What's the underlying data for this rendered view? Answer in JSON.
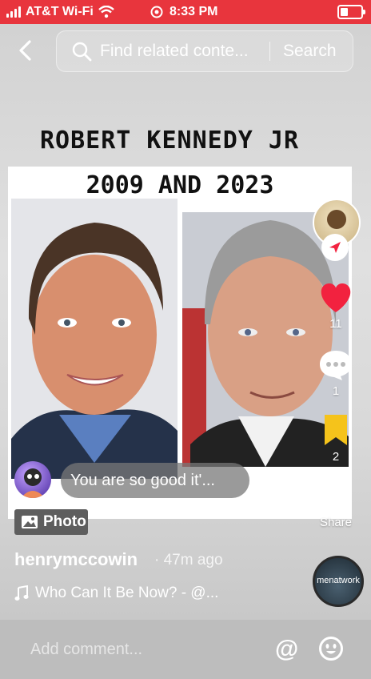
{
  "status": {
    "carrier": "AT&T Wi-Fi",
    "time": "8:33 PM",
    "bar_color": "#e8353d"
  },
  "search": {
    "placeholder": "Find related conte...",
    "button": "Search"
  },
  "post": {
    "title_line1": "ROBERT KENNEDY JR",
    "title_line2": "2009 AND 2023",
    "likes": "11",
    "comments": "1",
    "saves": "2",
    "share_label": "Share",
    "comment_preview": "You are so good it'...",
    "type_chip": "Photo",
    "username": "henrymccowin",
    "time_ago": "· 47m ago",
    "music": "Who Can It Be Now? - @...",
    "disc_text": "menatwork"
  },
  "composer": {
    "placeholder": "Add comment...",
    "mention": "@"
  },
  "colors": {
    "like": "#f2223f",
    "save": "#f5c31b"
  },
  "icons": [
    "back-icon",
    "search-icon",
    "wifi-icon",
    "alarm-icon",
    "battery-icon",
    "heart-icon",
    "comment-icon",
    "bookmark-icon",
    "share-icon",
    "photo-icon",
    "music-note-icon",
    "emoji-icon",
    "follow-icon"
  ]
}
